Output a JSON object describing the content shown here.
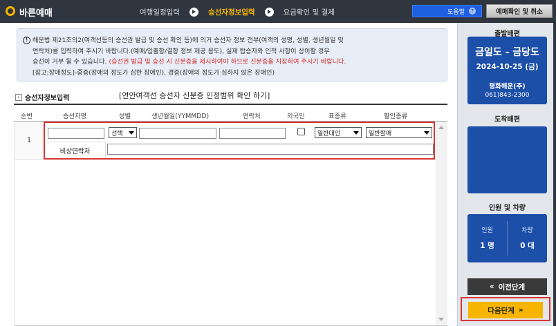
{
  "header": {
    "brand": "바른예매",
    "steps": [
      "여행일정입력",
      "승선자정보입력",
      "요금확인 및 결제"
    ],
    "active_step": 1,
    "help_label": "도움말",
    "help_icon": "question-icon",
    "confirm_label": "예매확인 및 취소"
  },
  "notice": {
    "line1": "해운법 제21조의2(여객선등의 승선권 발급 및 승선 확인 등)에 의거 승선자 정보 전부(여객의 성명, 성별, 생년월일 및",
    "line2": "연락처)를 입력하여 주시기 바랍니다.(예매/입출항/결항 정보 제공 용도), 실제 탑승자와 인적 사항이 상이할 경우",
    "line3_a": "승선이 거부 될 수 있습니다. ",
    "line3_b": "(승선권 발급 및 승선 시 신분증을 제시하여야 하므로 신분증을 지참하여 주시기 바랍니다.",
    "line4": "[참고:장애정도]-중증(장애의 정도가 심한 장애인), 경증(장애의 정도가 심하지 않은 장애인)"
  },
  "section": {
    "title": "승선자정보입력",
    "subtitle": "[연안여객선 승선자 신분증 인정범위 확인 하기]"
  },
  "table": {
    "headers": [
      "순번",
      "승선자명",
      "성별",
      "생년월일(YYMMDD)",
      "연락처",
      "외국인",
      "표종류",
      "할인종류"
    ],
    "rows": [
      {
        "index": "1",
        "name": "",
        "gender": "선택",
        "birth": "",
        "phone": "",
        "foreigner": false,
        "ticket_type": "일반대인",
        "discount_type": "일반할매",
        "emergency_label": "비상연락처",
        "emergency_value": ""
      }
    ]
  },
  "sidebar": {
    "depart_title": "출발배편",
    "route": "금일도 - 금당도",
    "date": "2024-10-25 (금)",
    "company": "평화해운(주)",
    "phone": "061)843-2300",
    "arrive_title": "도착배편",
    "counts_title": "인원 및 차량",
    "people_label": "인원",
    "people_value": "1 명",
    "car_label": "차량",
    "car_value": "0 대",
    "prev_label": "이전단계",
    "next_label": "다음단계"
  }
}
